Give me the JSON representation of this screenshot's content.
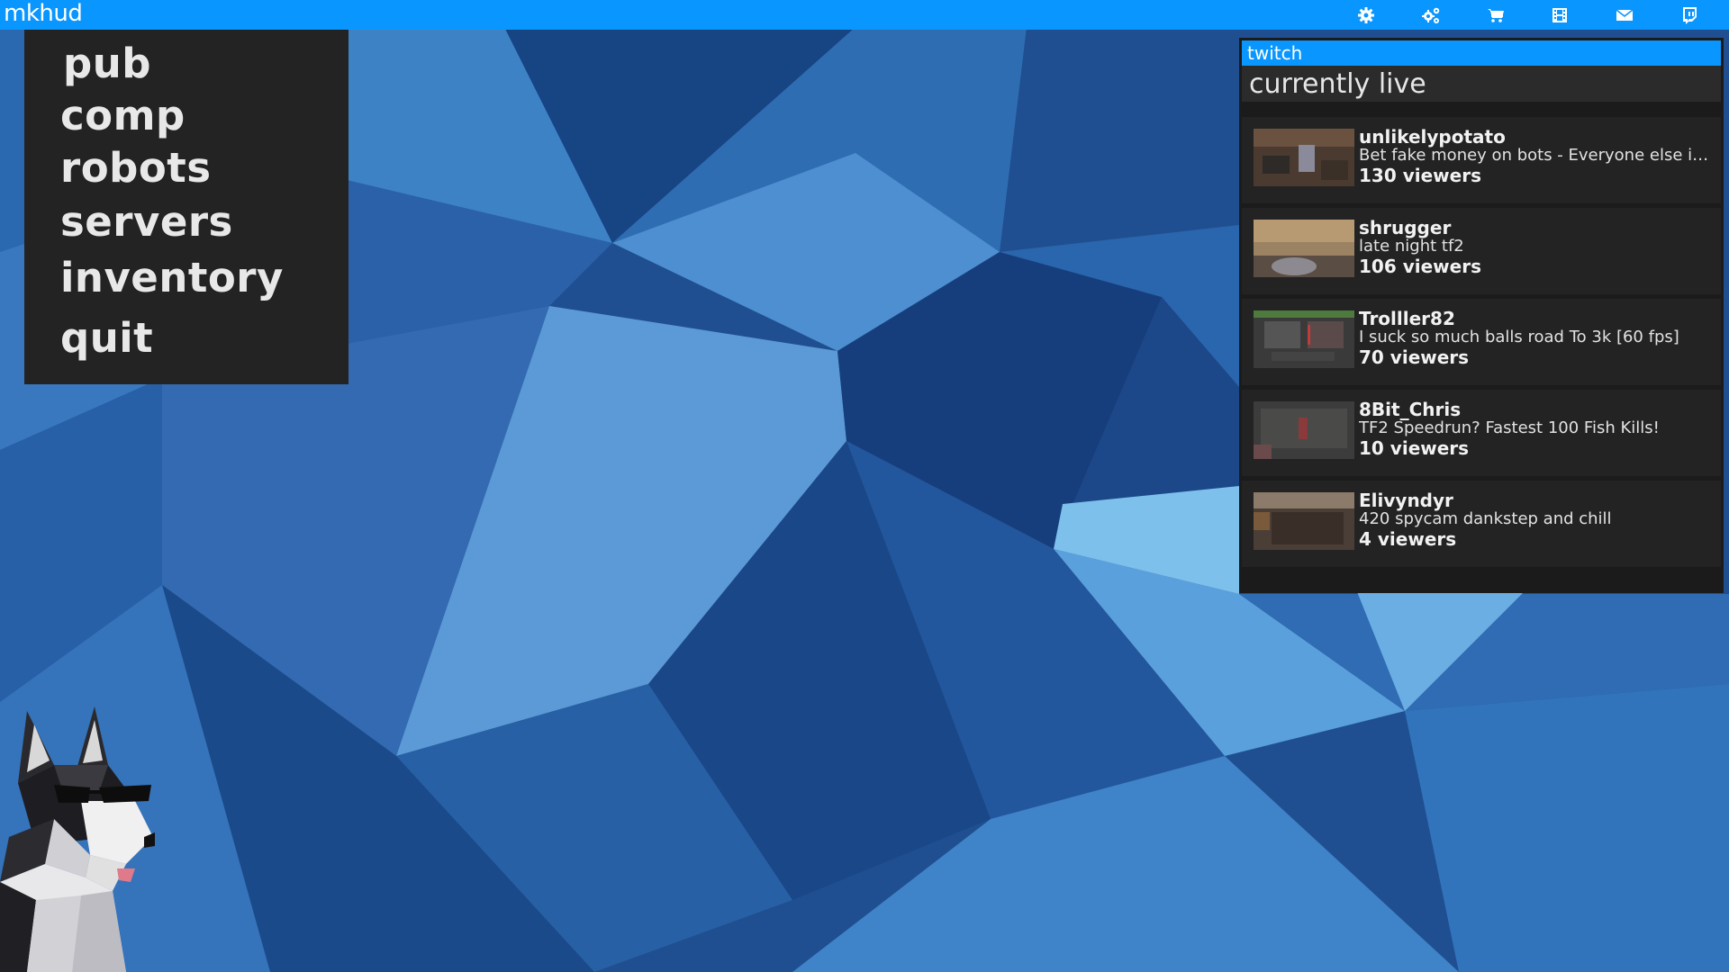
{
  "app": {
    "title": "mkhud"
  },
  "toolbar": {
    "icons": [
      {
        "name": "gear-icon"
      },
      {
        "name": "gears-icon"
      },
      {
        "name": "cart-icon"
      },
      {
        "name": "film-icon"
      },
      {
        "name": "mail-icon"
      },
      {
        "name": "twitch-icon"
      },
      {
        "name": "folder-open-icon"
      }
    ]
  },
  "main_menu": {
    "items": [
      {
        "label": "pub"
      },
      {
        "label": "comp"
      },
      {
        "label": "robots"
      },
      {
        "label": "servers"
      },
      {
        "label": "inventory"
      },
      {
        "label": "quit"
      }
    ]
  },
  "twitch": {
    "header": "twitch",
    "subheader": "currently live",
    "streams": [
      {
        "name": "unlikelypotato",
        "title": "Bet fake money on bots - Everyone else is …",
        "viewers": "130 viewers"
      },
      {
        "name": "shrugger",
        "title": "late night tf2",
        "viewers": "106 viewers"
      },
      {
        "name": "Trolller82",
        "title": "I suck so much balls road To 3k [60 fps]",
        "viewers": "70 viewers"
      },
      {
        "name": "8Bit_Chris",
        "title": "TF2 Speedrun? Fastest 100 Fish Kills!",
        "viewers": "10 viewers"
      },
      {
        "name": "Elivyndyr",
        "title": "420 spycam dankstep and chill",
        "viewers": "4 viewers"
      }
    ]
  },
  "colors": {
    "accent": "#0a96ff",
    "panel": "#232323",
    "panel_dark": "#1b1b1b"
  }
}
